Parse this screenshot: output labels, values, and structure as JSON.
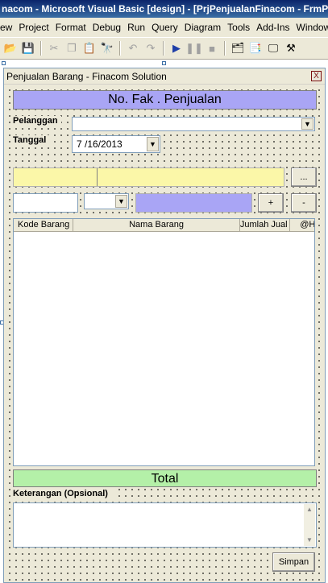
{
  "ide": {
    "title": "nacom - Microsoft Visual Basic [design] - [PrjPenjualanFinacom - FrmPenjualan (Form)]",
    "menu": [
      "ew",
      "Project",
      "Format",
      "Debug",
      "Run",
      "Query",
      "Diagram",
      "Tools",
      "Add-Ins",
      "Window"
    ],
    "toolbar_icons": [
      "save-icon",
      "open-icon",
      "cut-icon",
      "copy-icon",
      "paste-icon",
      "find-icon",
      "undo-icon",
      "redo-icon",
      "run-icon",
      "pause-icon",
      "stop-icon",
      "project-explorer-icon",
      "properties-icon",
      "form-layout-icon",
      "toolbox-icon"
    ]
  },
  "form": {
    "title": "Penjualan Barang - Finacom Solution",
    "close_glyph": "X",
    "no_faktur_label": "No. Fak . Penjualan",
    "pelanggan_label": "Pelanggan",
    "pelanggan_value": "",
    "tanggal_label": "Tanggal",
    "tanggal_value": "7 /16/2013",
    "browse_button": "...",
    "add_button": "+",
    "remove_button": "-",
    "grid_columns": [
      "Kode Barang",
      "Nama Barang",
      "Jumlah Jual",
      "@H"
    ],
    "total_label": "Total",
    "keterangan_label": "Keterangan (Opsional)",
    "keterangan_value": "",
    "simpan_button": "Simpan"
  },
  "colors": {
    "banner_purple": "#a9a5f5",
    "total_green": "#b4f0a8",
    "item_yellow": "#fbf7a8",
    "form_bg": "#ece9d8"
  }
}
